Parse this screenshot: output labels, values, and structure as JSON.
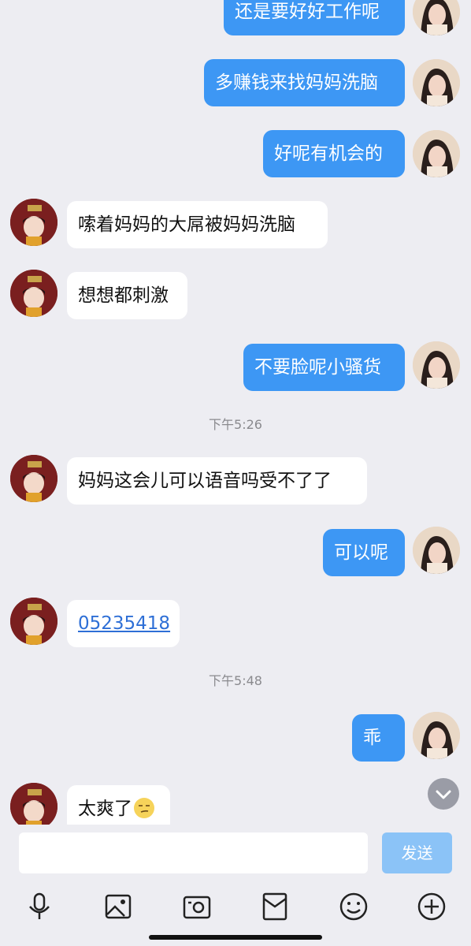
{
  "messages": [
    {
      "side": "out",
      "text": "还是要好好工作呢"
    },
    {
      "side": "out",
      "text": "多赚钱来找妈妈洗脑"
    },
    {
      "side": "out",
      "text": "好呢有机会的"
    },
    {
      "side": "in",
      "text": "嗦着妈妈的大屌被妈妈洗脑"
    },
    {
      "side": "in",
      "text": "想想都刺激"
    },
    {
      "side": "out",
      "text": "不要脸呢小骚货"
    },
    {
      "side": "time",
      "text": "下午5:26"
    },
    {
      "side": "in",
      "text": "妈妈这会儿可以语音吗受不了了"
    },
    {
      "side": "out",
      "text": "可以呢"
    },
    {
      "side": "in",
      "text": "05235418",
      "link": true
    },
    {
      "side": "time",
      "text": "下午5:48"
    },
    {
      "side": "out",
      "text": "乖"
    },
    {
      "side": "in",
      "text": "太爽了",
      "emoji": "smirk-emoji"
    }
  ],
  "composer": {
    "input_value": "",
    "send_label": "发送"
  },
  "toolbar": {
    "icons": [
      "microphone-icon",
      "image-icon",
      "camera-icon",
      "red-packet-icon",
      "emoji-icon",
      "plus-icon"
    ]
  },
  "colors": {
    "background": "#ededf2",
    "outgoing_bubble": "#3d97f4",
    "incoming_bubble": "#ffffff",
    "send_button": "#8bc3f7"
  }
}
